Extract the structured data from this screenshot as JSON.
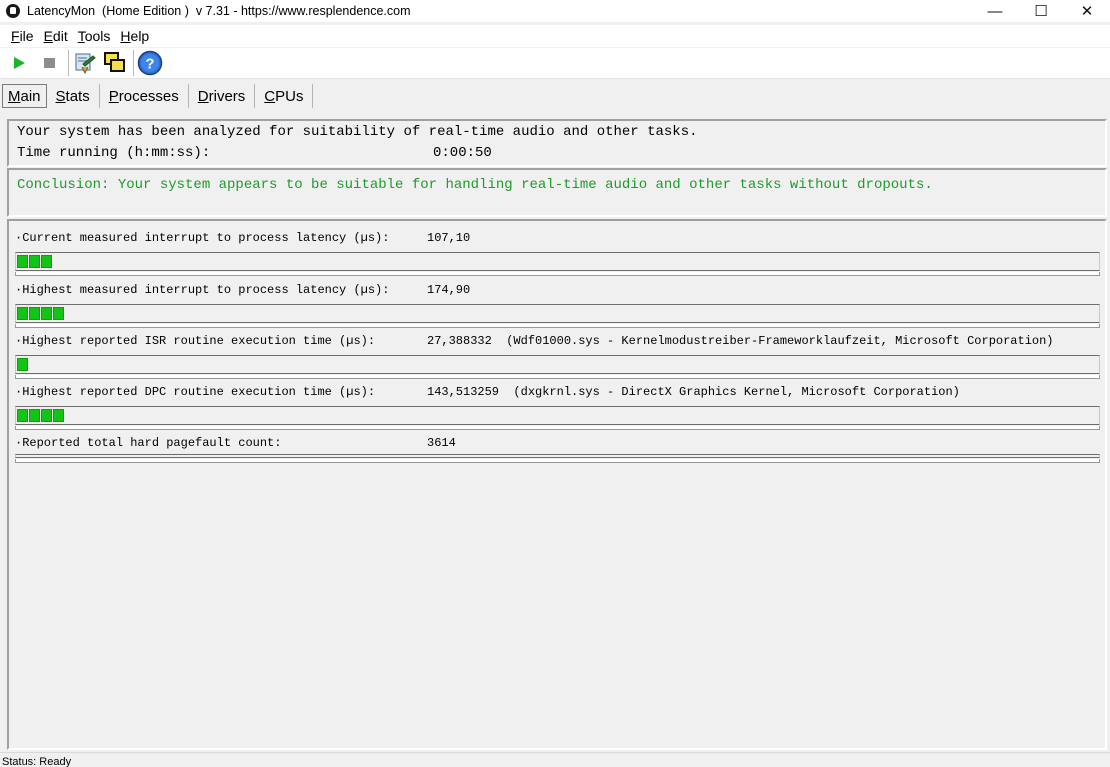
{
  "window": {
    "title": "LatencyMon  (Home Edition )  v 7.31 - https://www.resplendence.com",
    "controls": {
      "minimize": "—",
      "maximize": "☐",
      "close": "✕"
    }
  },
  "menu": [
    {
      "first": "F",
      "rest": "ile"
    },
    {
      "first": "E",
      "rest": "dit"
    },
    {
      "first": "T",
      "rest": "ools"
    },
    {
      "first": "H",
      "rest": "elp"
    }
  ],
  "toolbar": {
    "icons": [
      "play-icon",
      "stop-icon",
      "report-icon",
      "windows-icon",
      "help-icon"
    ],
    "help_glyph": "?"
  },
  "tabs": [
    {
      "first": "M",
      "rest": "ain",
      "active": true
    },
    {
      "first": "S",
      "rest": "tats"
    },
    {
      "first": "P",
      "rest": "rocesses"
    },
    {
      "first": "D",
      "rest": "rivers"
    },
    {
      "first": "C",
      "rest": "PUs"
    }
  ],
  "summary": {
    "analyzed": "Your system has been analyzed for suitability of real-time audio and other tasks.",
    "time_label": "Time running (h:mm:ss):",
    "time_value": "0:00:50"
  },
  "conclusion": "Conclusion: Your system appears to be suitable for handling real-time audio and other tasks without dropouts.",
  "metrics": [
    {
      "label": "·Current measured interrupt to process latency (µs):",
      "value": "107,10",
      "segments": 3
    },
    {
      "label": "·Highest measured interrupt to process latency (µs):",
      "value": "174,90",
      "segments": 4
    },
    {
      "label": "·Highest reported ISR routine execution time (µs):",
      "value": "27,388332  (Wdf01000.sys - Kernelmodustreiber-Frameworklaufzeit, Microsoft Corporation)",
      "segments": 1
    },
    {
      "label": "·Highest reported DPC routine execution time (µs):",
      "value": "143,513259  (dxgkrnl.sys - DirectX Graphics Kernel, Microsoft Corporation)",
      "segments": 4
    },
    {
      "label": "·Reported total hard pagefault count:",
      "value": "3614",
      "segments": 0
    }
  ],
  "status": "Status: Ready",
  "colors": {
    "bar_green": "#13c414",
    "conclusion_green": "#1f9a2b",
    "play_green": "#18b52a"
  }
}
